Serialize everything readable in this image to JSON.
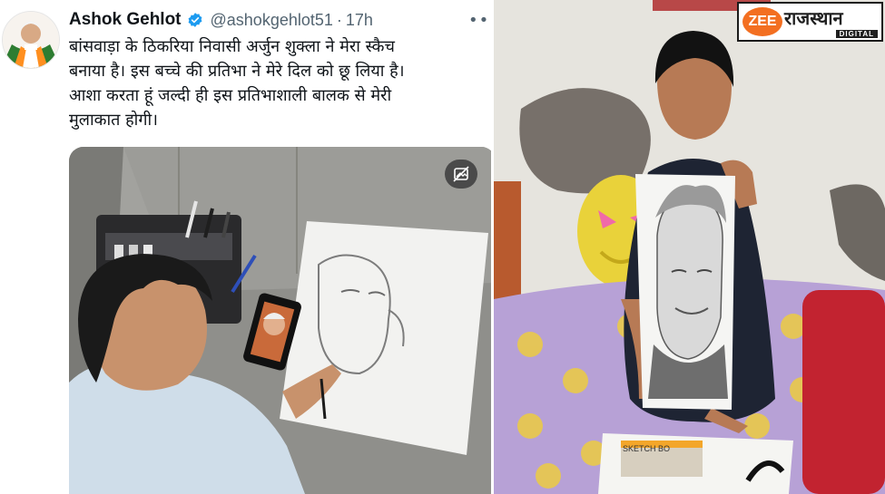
{
  "tweet": {
    "author_name": "Ashok Gehlot",
    "handle": "@ashokgehlot51",
    "separator": "·",
    "timestamp": "17h",
    "more_icon": "more-horizontal-icon",
    "text_lines": [
      "बांसवाड़ा के ठिकरिया निवासी अर्जुन शुक्ला ने मेरा स्कैच",
      "बनाया है। इस बच्चे की प्रतिभा ने मेरे दिल को छू लिया है।",
      "आशा करता हूं जल्दी ही इस प्रतिभाशाली बालक से मेरी",
      "मुलाकात होगी।"
    ],
    "verified_color": "#1d9bf0"
  },
  "media": {
    "description_icon": "image-description-icon"
  },
  "logo": {
    "brand": "ZEE",
    "title": "राजस्थान",
    "subtitle": "DIGITAL",
    "brand_color": "#f36f21"
  },
  "sketchbook": {
    "label": "SKETCH BO"
  }
}
